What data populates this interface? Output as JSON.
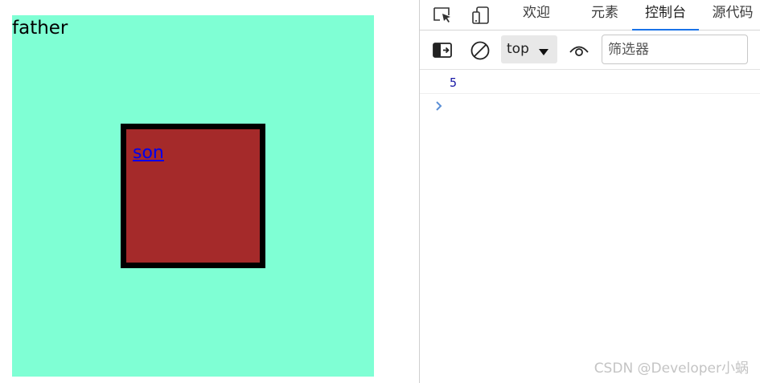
{
  "preview": {
    "father_label": "father",
    "son_link": "son"
  },
  "devtools": {
    "tabs": [
      {
        "label": "欢迎"
      },
      {
        "label": "元素"
      },
      {
        "label": "控制台",
        "active": true
      },
      {
        "label": "源代码"
      }
    ],
    "toolbar": {
      "context_value": "top",
      "filter_placeholder": "筛选器"
    },
    "console": {
      "logs": [
        "5"
      ]
    }
  },
  "watermark": "CSDN @Developer小蜗",
  "icons": {
    "inspect": "inspect-element-icon",
    "device": "device-emulation-icon",
    "sidebar": "show-console-sidebar-icon",
    "clear": "clear-console-icon",
    "dropdown": "caret-down-icon",
    "live_expression": "eye-icon",
    "prompt": "chevron-right-icon"
  },
  "colors": {
    "father_bg": "#7fffd4",
    "son_bg": "#a52a2a",
    "son_border": "#000000",
    "link": "#0000ee",
    "active_tab_underline": "#1a73e8",
    "log_number": "#1a1aa6"
  }
}
